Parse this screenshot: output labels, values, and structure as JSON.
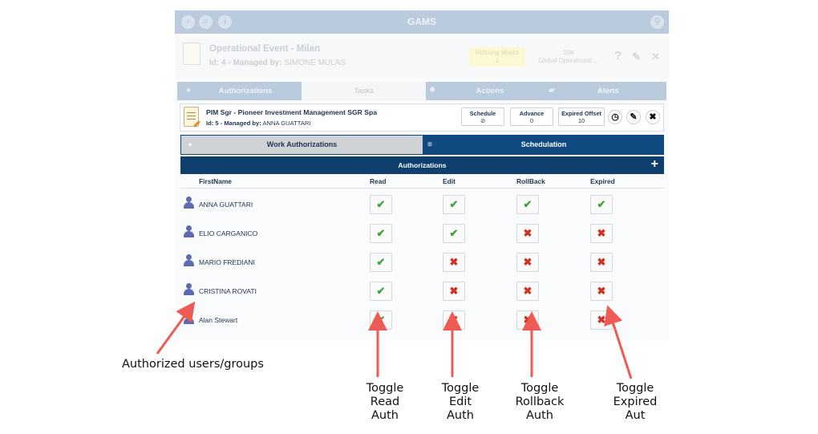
{
  "app": {
    "title": "GAMS",
    "accent": "#0f4a80",
    "topbar_icons": [
      "back-icon",
      "menu-icon",
      "info-icon",
      "search-icon"
    ]
  },
  "event": {
    "name": "Operational Event - Milan",
    "id_prefix": "Id: 4 - Managed by:",
    "manager": "SIMONE MULAS",
    "running_label": "Running Works",
    "running_value": "1",
    "site_label": "Site",
    "site_value": "Global Operational ...",
    "help_symbol": "?",
    "edit_symbol": "✎",
    "close_symbol": "✕"
  },
  "tabs": [
    {
      "label": "Authorizations",
      "icon": "user-icon"
    },
    {
      "label": "Tasks",
      "icon": "list-icon"
    },
    {
      "label": "Actions",
      "icon": "gear-icon"
    },
    {
      "label": "Alerts",
      "icon": "chat-icon"
    }
  ],
  "work": {
    "name": "PIM Sgr - Pioneer Investment Management SGR Spa",
    "id_prefix": "Id: 5 - Managed by:",
    "manager": "ANNA GUATTARI",
    "schedule_label": "Schedule",
    "schedule_value": "⊘",
    "advance_label": "Advance",
    "advance_value": "0",
    "expired_label": "Expired Offset",
    "expired_value": "10"
  },
  "subtabs": {
    "work_auth": "Work Authorizations",
    "schedulation": "Schedulation"
  },
  "auth": {
    "title": "Authorizations",
    "add_symbol": "+",
    "columns": [
      "FirstName",
      "Read",
      "Edit",
      "RollBack",
      "Expired"
    ],
    "rows": [
      {
        "name": "ANNA GUATTARI",
        "read": true,
        "edit": true,
        "rollback": true,
        "expired": true
      },
      {
        "name": "ELIO CARGANICO",
        "read": true,
        "edit": true,
        "rollback": false,
        "expired": false
      },
      {
        "name": "MARIO FREDIANI",
        "read": true,
        "edit": false,
        "rollback": false,
        "expired": false
      },
      {
        "name": "CRISTINA ROVATI",
        "read": true,
        "edit": false,
        "rollback": false,
        "expired": false
      },
      {
        "name": "Alan Stewart",
        "read": true,
        "edit": false,
        "rollback": false,
        "expired": false
      }
    ],
    "on_symbol": "✔",
    "off_symbol": "✖"
  },
  "annotations": {
    "users": "Authorized users/groups",
    "read": [
      "Toggle",
      "Read",
      "Auth"
    ],
    "edit": [
      "Toggle",
      "Edit",
      "Auth"
    ],
    "rollback": [
      "Toggle",
      "Rollback",
      "Auth"
    ],
    "expired": [
      "Toggle",
      "Expired",
      "Aut"
    ],
    "arrow_color": "#ee5b55"
  }
}
